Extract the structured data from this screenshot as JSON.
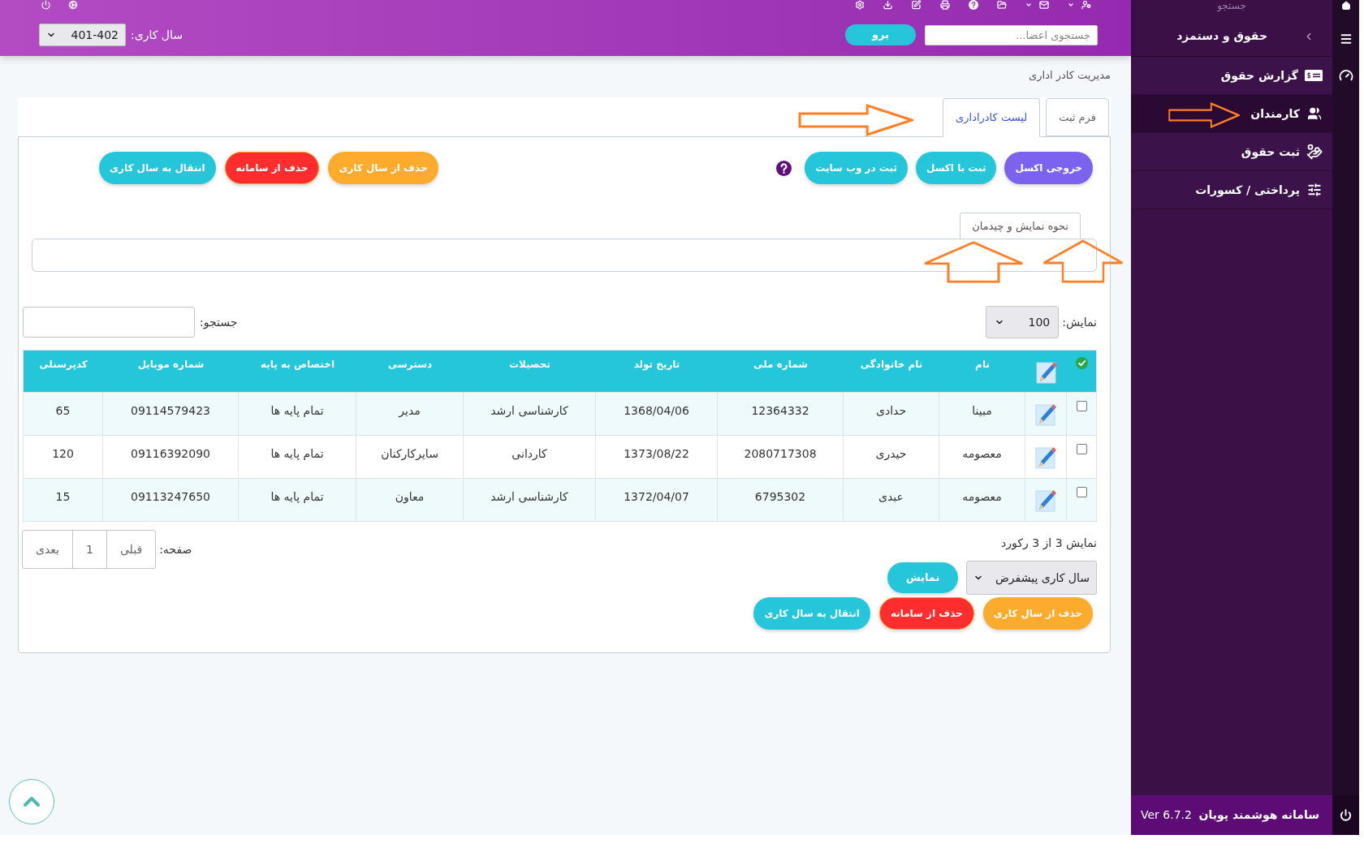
{
  "topbar": {
    "member_search": {
      "placeholder": "جستجوی اعضا..."
    },
    "go_button": "برو",
    "work_year": {
      "label": "سال کاری:",
      "value": "401-402"
    }
  },
  "sidebar": {
    "search": {
      "placeholder": "جستجو"
    },
    "section": {
      "label": "حقوق و دستمزد"
    },
    "items": [
      {
        "label": "گزارش حقوق",
        "selected": false
      },
      {
        "label": "کارمندان",
        "selected": true
      },
      {
        "label": "ثبت حقوق",
        "selected": false
      },
      {
        "label": "پرداختی / کسورات",
        "selected": false
      }
    ],
    "footer": {
      "title": "سامانه هوشمند پویان",
      "version": "Ver 6.7.2"
    }
  },
  "page_title": "مدیریت کادر اداری",
  "tabs": [
    {
      "label": "فرم ثبت",
      "selected": false
    },
    {
      "label": "لیست کادراداری",
      "selected": true
    }
  ],
  "toolbar": {
    "main_buttons": [
      {
        "label": "خروجی اکسل",
        "kind": "primary"
      },
      {
        "label": "ثبت با اکسل",
        "kind": "info"
      },
      {
        "label": "ثبت در وب سایت",
        "kind": "info"
      }
    ],
    "action_buttons": [
      {
        "label": "حذف از سال کاری",
        "kind": "warning"
      },
      {
        "label": "حذف از سامانه",
        "kind": "danger"
      },
      {
        "label": "انتقال به سال کاری",
        "kind": "info"
      }
    ]
  },
  "layout_section": {
    "label": "نحوه نمایش و چیدمان"
  },
  "table_controls": {
    "page_size_label": "نمایش:",
    "page_size": "100",
    "search_label": "جستجو:"
  },
  "table": {
    "columns": [
      "نام",
      "نام خانوادگی",
      "شماره ملی",
      "تاریخ تولد",
      "تحصیلات",
      "دسترسی",
      "اختصاص به پایه",
      "شماره موبایل",
      "کدپرسنلی"
    ],
    "rows": [
      {
        "checked": false,
        "cells": [
          "مبینا",
          "حدادی",
          "12364332",
          "1368/04/06",
          "کارشناسی ارشد",
          "مدیر",
          "تمام پایه ها",
          "09114579423",
          "65"
        ]
      },
      {
        "checked": false,
        "cells": [
          "معصومه",
          "حیدری",
          "2080717308",
          "1373/08/22",
          "کاردانی",
          "سایرکارکنان",
          "تمام پایه ها",
          "09116392090",
          "120"
        ]
      },
      {
        "checked": false,
        "cells": [
          "معصومه",
          "عبدی",
          "6795302",
          "1372/04/07",
          "کارشناسی ارشد",
          "معاون",
          "تمام پایه ها",
          "09113247650",
          "15"
        ]
      }
    ]
  },
  "table_footer": {
    "summary": "نمایش 3 از 3 رکورد",
    "page_label": "صفحه:",
    "pages": [
      "قبلی",
      "1",
      "بعدی"
    ],
    "year_select": "سال کاری پیشفرض",
    "show_button": "نمایش",
    "buttons": [
      {
        "label": "حذف از سال کاری",
        "kind": "warning"
      },
      {
        "label": "حذف از سامانه",
        "kind": "danger"
      },
      {
        "label": "انتقال به سال کاری",
        "kind": "info"
      }
    ]
  }
}
